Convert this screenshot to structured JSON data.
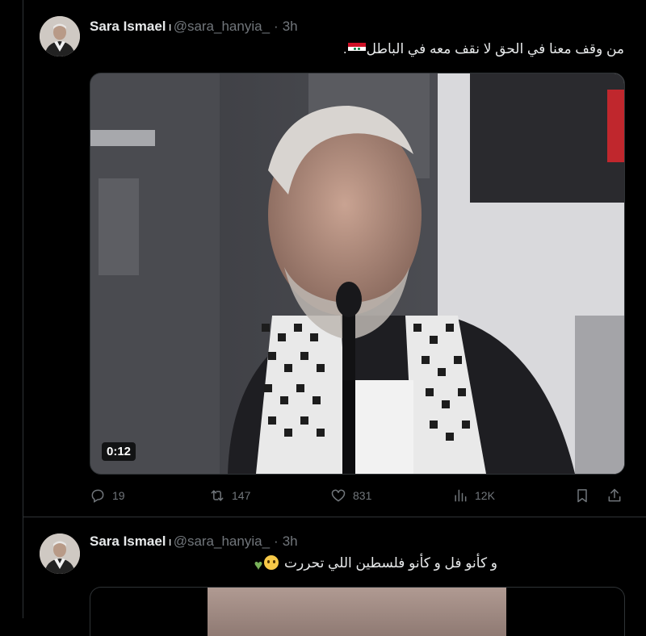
{
  "tweets": [
    {
      "author_name": "Sara Ismael",
      "verified_mark": "ı",
      "handle": "@sara_hanyia_",
      "separator": "·",
      "time": "3h",
      "text": "من وقف معنا في الحق لا نقف معه في الباطل",
      "text_suffix": ".",
      "flag_icon": "syria-flag-icon",
      "media": {
        "type": "video",
        "duration": "0:12"
      },
      "actions": {
        "replies": "19",
        "retweets": "147",
        "likes": "831",
        "views": "12K"
      }
    },
    {
      "author_name": "Sara Ismael",
      "verified_mark": "ı",
      "handle": "@sara_hanyia_",
      "separator": "·",
      "time": "3h",
      "text": "و كأنو فل و كأنو فلسطين اللي تحررت",
      "emoji_icons": [
        "pleading-face-icon",
        "green-heart-icon"
      ]
    }
  ],
  "colors": {
    "background": "#000000",
    "text_primary": "#e7e9ea",
    "text_secondary": "#71767b",
    "border": "#2f3336"
  }
}
